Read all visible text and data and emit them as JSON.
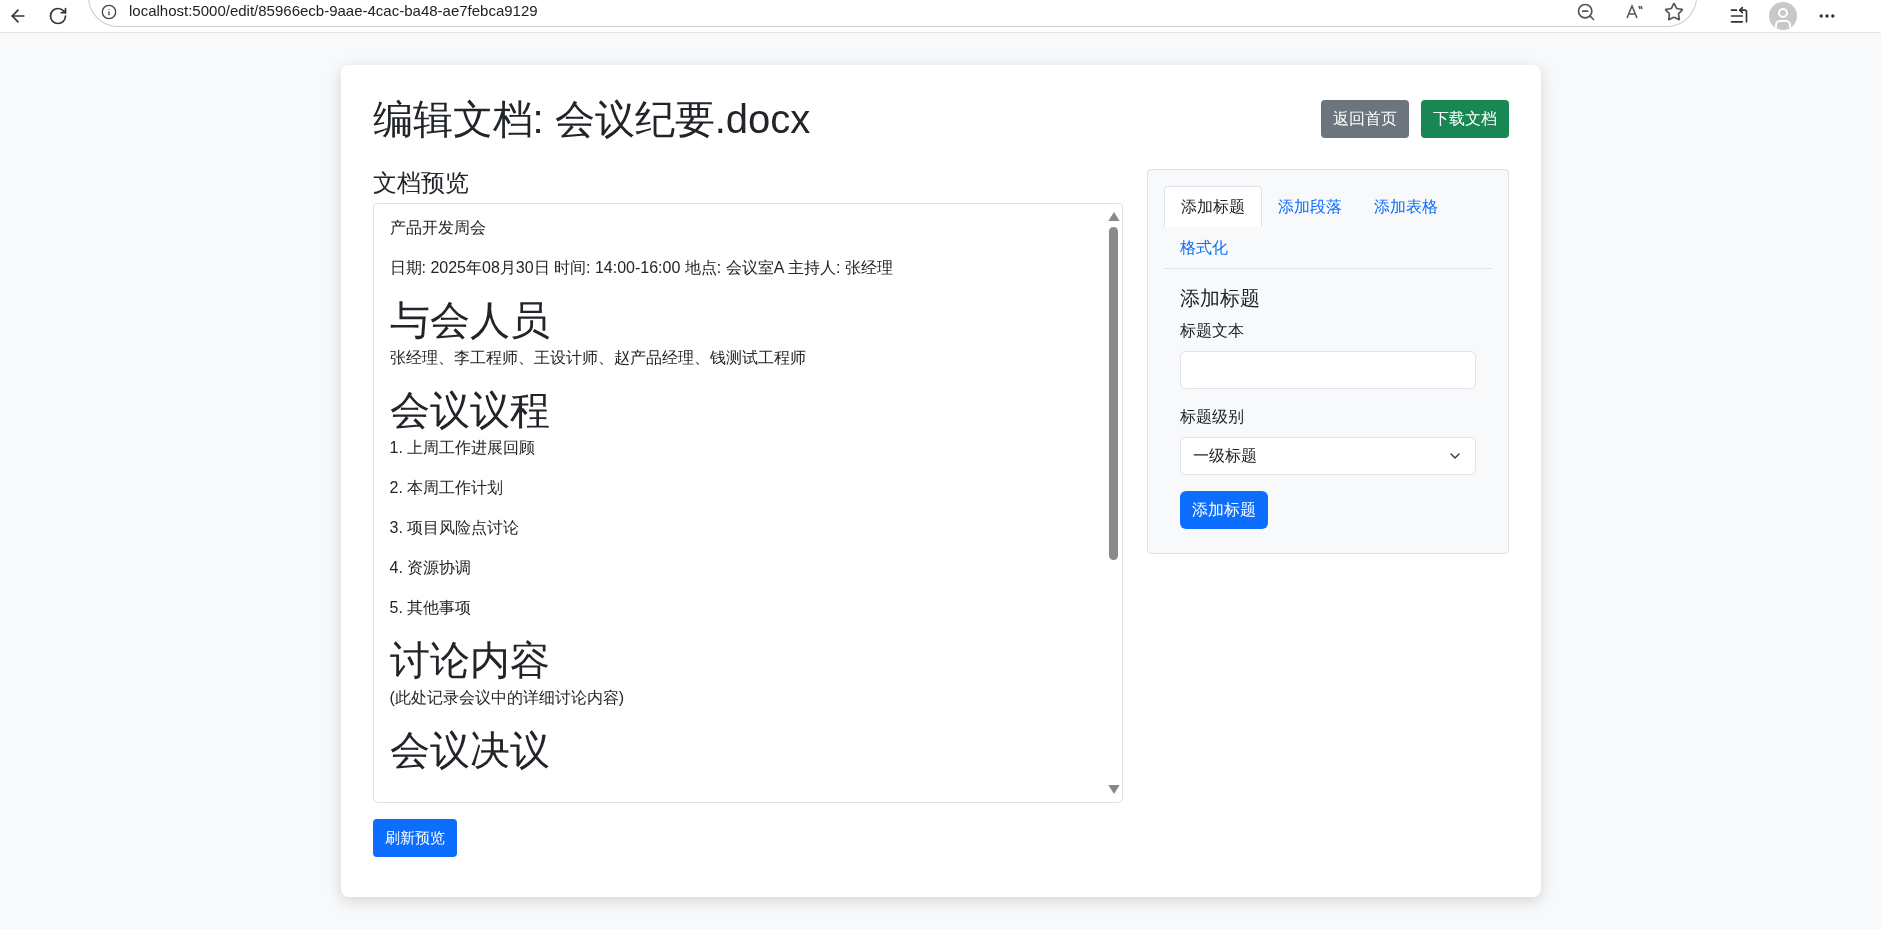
{
  "browser": {
    "url": "localhost:5000/edit/85966ecb-9aae-4cac-ba48-ae7febca9129"
  },
  "page": {
    "title": "编辑文档: 会议纪要.docx",
    "buttons": [
      {
        "label": "返回首页",
        "kind": "secondary"
      },
      {
        "label": "下载文档",
        "kind": "success"
      }
    ]
  },
  "preview": {
    "heading": "文档预览",
    "content": [
      {
        "kind": "p",
        "text": "产品开发周会"
      },
      {
        "kind": "p",
        "text": "日期: 2025年08月30日 时间: 14:00-16:00 地点: 会议室A 主持人: 张经理"
      },
      {
        "kind": "h1",
        "text": "与会人员"
      },
      {
        "kind": "p",
        "text": "张经理、李工程师、王设计师、赵产品经理、钱测试工程师"
      },
      {
        "kind": "h1",
        "text": "会议议程"
      },
      {
        "kind": "p",
        "text": "1. 上周工作进展回顾"
      },
      {
        "kind": "p",
        "text": "2. 本周工作计划"
      },
      {
        "kind": "p",
        "text": "3. 项目风险点讨论"
      },
      {
        "kind": "p",
        "text": "4. 资源协调"
      },
      {
        "kind": "p",
        "text": "5. 其他事项"
      },
      {
        "kind": "h1",
        "text": "讨论内容"
      },
      {
        "kind": "p",
        "text": "(此处记录会议中的详细讨论内容)"
      },
      {
        "kind": "h1",
        "text": "会议决议"
      }
    ],
    "refresh_button": "刷新预览"
  },
  "panel": {
    "tabs": [
      {
        "label": "添加标题",
        "selected": true
      },
      {
        "label": "添加段落",
        "selected": false
      },
      {
        "label": "添加表格",
        "selected": false
      },
      {
        "label": "格式化",
        "selected": false
      }
    ],
    "form_title": "添加标题",
    "text_label": "标题文本",
    "level_label": "标题级别",
    "level_value": "一级标题",
    "submit": "添加标题"
  }
}
